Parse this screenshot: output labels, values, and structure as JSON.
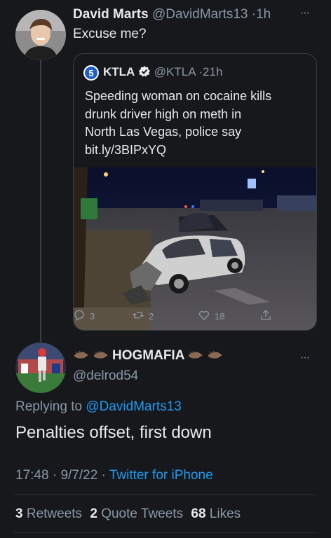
{
  "tweet1": {
    "name": "David Marts",
    "handle": "@DavidMarts13",
    "sep": "·",
    "time": "1h",
    "text": "Excuse me?",
    "more": "···"
  },
  "quote": {
    "name": "KTLA",
    "handle": "@KTLA",
    "sep": "·",
    "time": "21h",
    "text_lines": [
      "Speeding woman on cocaine kills",
      "drunk driver high on meth in",
      "North Las Vegas, police say",
      "bit.ly/3BIPxYQ"
    ],
    "logo_text": "5"
  },
  "actions": {
    "replies": "3",
    "retweets": "2",
    "likes": "18"
  },
  "tweet2": {
    "name": "HOGMAFIA",
    "handle": "@delrod54",
    "replying_prefix": "Replying to ",
    "replying_to": "@DavidMarts13",
    "text": "Penalties offset, first down",
    "time": "17:48",
    "date": "9/7/22",
    "dot": "·",
    "source": "Twitter for iPhone",
    "more": "···"
  },
  "stats": {
    "retweets_count": "3",
    "retweets_label": "Retweets",
    "quotes_count": "2",
    "quotes_label": "Quote Tweets",
    "likes_count": "68",
    "likes_label": "Likes"
  },
  "colors": {
    "background": "#16181c",
    "text": "#e7e9ea",
    "secondary": "#8b98a5",
    "link": "#1d9bf0",
    "verified": "#e7c33a"
  }
}
